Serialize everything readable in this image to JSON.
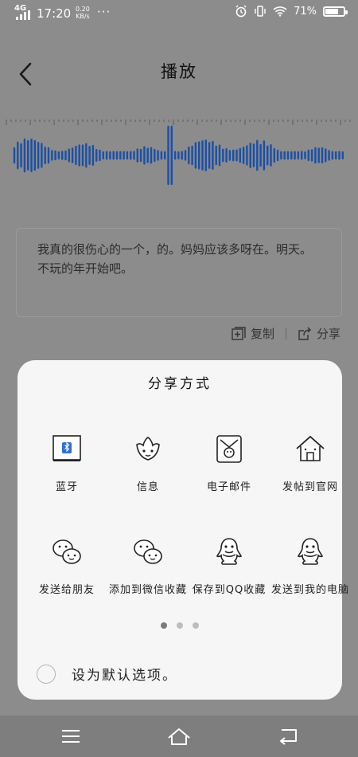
{
  "status_bar": {
    "network": "4G",
    "time": "17:20",
    "speed_value": "0.20",
    "speed_unit": "KB/s",
    "dots": "···",
    "battery_text": "71%",
    "battery_level": 0.71
  },
  "header": {
    "title": "播放"
  },
  "transcript": {
    "text": "我真的很伤心的一个，的。妈妈应该多呀在。明天。不玩的年开始吧。"
  },
  "actions": {
    "copy_label": "复制",
    "share_label": "分享"
  },
  "share_sheet": {
    "title": "分享方式",
    "items": [
      {
        "label": "蓝牙",
        "icon": "bluetooth-icon"
      },
      {
        "label": "信息",
        "icon": "message-icon"
      },
      {
        "label": "电子邮件",
        "icon": "email-icon"
      },
      {
        "label": "发帖到官网",
        "icon": "house-icon"
      },
      {
        "label": "发送给朋友",
        "icon": "wechat-icon"
      },
      {
        "label": "添加到微信收藏",
        "icon": "wechat-icon"
      },
      {
        "label": "保存到QQ收藏",
        "icon": "qq-penguin-icon"
      },
      {
        "label": "发送到我的电脑",
        "icon": "qq-penguin-icon"
      }
    ],
    "pager": {
      "pages": 3,
      "current": 1
    },
    "default_option_label": "设为默认选项。"
  },
  "colors": {
    "waveform": "#1a4fa8",
    "overlay_bg": "#8c8c8c",
    "sheet_bg": "#f6f6f6"
  }
}
